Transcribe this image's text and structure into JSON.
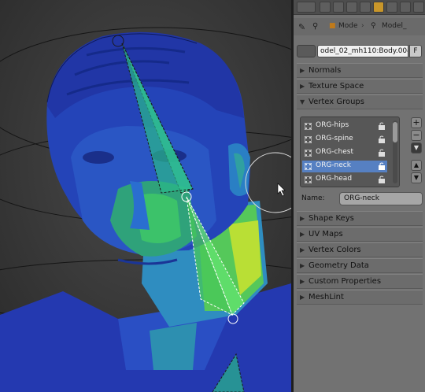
{
  "header": {
    "icons": [
      "render-icon",
      "scene-icon",
      "world-icon",
      "object-icon",
      "constraint-icon",
      "modifiers-icon",
      "data-icon",
      "physics-icon",
      "wrench-icon"
    ]
  },
  "context": {
    "pin_icon": "pin-icon",
    "mode_label": "Mode",
    "model_label": "Model_"
  },
  "mesh": {
    "datablock_name": "odel_02_mh110:Body.004",
    "fake_user_label": "F"
  },
  "sections": {
    "normals": "Normals",
    "texture_space": "Texture Space",
    "vertex_groups": "Vertex Groups",
    "shape_keys": "Shape Keys",
    "uv_maps": "UV Maps",
    "vertex_colors": "Vertex Colors",
    "geometry_data": "Geometry Data",
    "custom_properties": "Custom Properties",
    "meshlint": "MeshLint"
  },
  "vertex_groups": {
    "items": [
      "ORG-hips",
      "ORG-spine",
      "ORG-chest",
      "ORG-neck",
      "ORG-head"
    ],
    "active_index": 3,
    "name_label": "Name:",
    "name_value": "ORG-neck",
    "buttons": [
      "+",
      "−",
      "▼",
      "▲",
      "▼"
    ]
  },
  "colors": {
    "panel_bg": "#727272",
    "active_row": "#5680c2",
    "weight_blue": "#2a45b8",
    "weight_green": "#39c46a",
    "weight_yellow": "#d9e82c"
  }
}
